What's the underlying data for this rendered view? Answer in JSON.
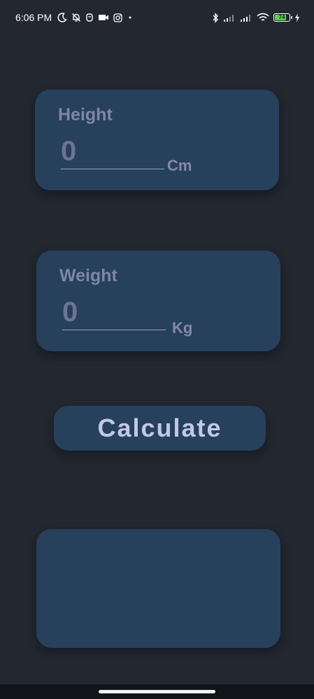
{
  "status_bar": {
    "time": "6:06 PM",
    "left_icons": [
      "moon-icon",
      "bell-off-icon",
      "app-icon",
      "video-icon",
      "instagram-icon",
      "dot-icon"
    ],
    "right_icons": [
      "bluetooth-icon",
      "signal-icon",
      "signal-icon",
      "wifi-icon",
      "battery-icon",
      "charging-icon"
    ],
    "battery_level": "74"
  },
  "height_card": {
    "label": "Height",
    "value": "0",
    "unit": "Cm"
  },
  "weight_card": {
    "label": "Weight",
    "value": "0",
    "unit": "Kg"
  },
  "calculate_button": {
    "label": "Calculate"
  },
  "colors": {
    "background": "#222730",
    "card": "#27405c",
    "label": "#7f86a3",
    "button_text": "#c1c8e6",
    "battery_fill": "#5ad24a"
  }
}
